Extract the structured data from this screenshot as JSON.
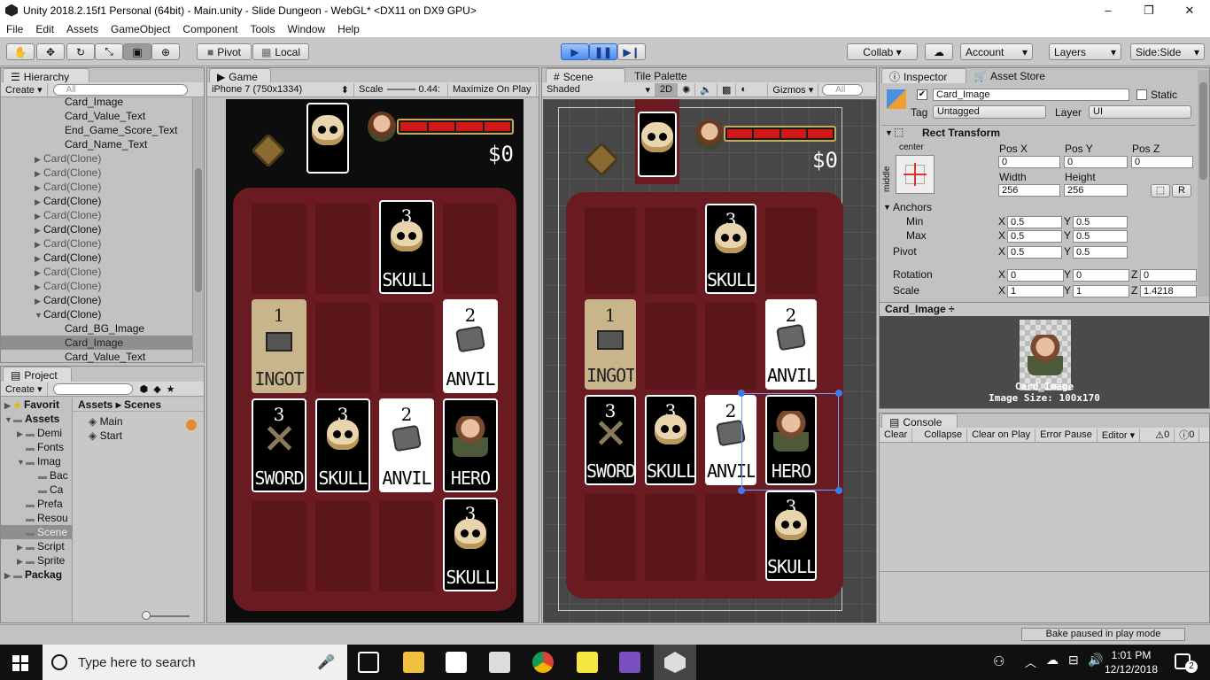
{
  "window": {
    "title": "Unity 2018.2.15f1 Personal (64bit) - Main.unity - Slide Dungeon - WebGL* <DX11 on DX9 GPU>",
    "minimize": "–",
    "maximize": "❐",
    "close": "✕"
  },
  "menu": [
    "File",
    "Edit",
    "Assets",
    "GameObject",
    "Component",
    "Tools",
    "Window",
    "Help"
  ],
  "toolbar": {
    "pivot_label": "Pivot",
    "local_label": "Local",
    "collab_label": "Collab ▾",
    "account_label": "Account",
    "layers_label": "Layers",
    "layout_label": "Side:Side"
  },
  "hierarchy": {
    "tab": "Hierarchy",
    "create": "Create ▾",
    "search_placeholder": "All",
    "rows": [
      {
        "label": "Card_Image",
        "indent": 2,
        "style": "normal",
        "arrow": ""
      },
      {
        "label": "Card_Value_Text",
        "indent": 2,
        "style": "normal",
        "arrow": ""
      },
      {
        "label": "End_Game_Score_Text",
        "indent": 2,
        "style": "normal",
        "arrow": ""
      },
      {
        "label": "Card_Name_Text",
        "indent": 2,
        "style": "normal",
        "arrow": ""
      },
      {
        "label": "Card(Clone)",
        "indent": 1,
        "style": "grey",
        "arrow": "▶"
      },
      {
        "label": "Card(Clone)",
        "indent": 1,
        "style": "grey",
        "arrow": "▶"
      },
      {
        "label": "Card(Clone)",
        "indent": 1,
        "style": "grey",
        "arrow": "▶"
      },
      {
        "label": "Card(Clone)",
        "indent": 1,
        "style": "normal",
        "arrow": "▶"
      },
      {
        "label": "Card(Clone)",
        "indent": 1,
        "style": "grey",
        "arrow": "▶"
      },
      {
        "label": "Card(Clone)",
        "indent": 1,
        "style": "normal",
        "arrow": "▶"
      },
      {
        "label": "Card(Clone)",
        "indent": 1,
        "style": "grey",
        "arrow": "▶"
      },
      {
        "label": "Card(Clone)",
        "indent": 1,
        "style": "normal",
        "arrow": "▶"
      },
      {
        "label": "Card(Clone)",
        "indent": 1,
        "style": "grey",
        "arrow": "▶"
      },
      {
        "label": "Card(Clone)",
        "indent": 1,
        "style": "grey",
        "arrow": "▶"
      },
      {
        "label": "Card(Clone)",
        "indent": 1,
        "style": "normal",
        "arrow": "▶"
      },
      {
        "label": "Card(Clone)",
        "indent": 1,
        "style": "normal",
        "arrow": "▼"
      },
      {
        "label": "Card_BG_Image",
        "indent": 2,
        "style": "normal",
        "arrow": ""
      },
      {
        "label": "Card_Image",
        "indent": 2,
        "style": "sel",
        "arrow": ""
      },
      {
        "label": "Card_Value_Text",
        "indent": 2,
        "style": "normal",
        "arrow": ""
      }
    ]
  },
  "project": {
    "tab": "Project",
    "create": "Create ▾",
    "tree": [
      {
        "label": "Favorit",
        "bold": true,
        "arrow": "▶",
        "indent": 0
      },
      {
        "label": "Assets",
        "bold": true,
        "arrow": "▼",
        "indent": 0
      },
      {
        "label": "Demi",
        "bold": false,
        "arrow": "▶",
        "indent": 1
      },
      {
        "label": "Fonts",
        "bold": false,
        "arrow": "",
        "indent": 1
      },
      {
        "label": "Imag",
        "bold": false,
        "arrow": "▼",
        "indent": 1
      },
      {
        "label": "Bac",
        "bold": false,
        "arrow": "",
        "indent": 2
      },
      {
        "label": "Ca",
        "bold": false,
        "arrow": "",
        "indent": 2
      },
      {
        "label": "Prefa",
        "bold": false,
        "arrow": "",
        "indent": 1
      },
      {
        "label": "Resou",
        "bold": false,
        "arrow": "",
        "indent": 1
      },
      {
        "label": "Scene",
        "bold": false,
        "arrow": "",
        "indent": 1,
        "selected": true
      },
      {
        "label": "Script",
        "bold": false,
        "arrow": "▶",
        "indent": 1
      },
      {
        "label": "Sprite",
        "bold": false,
        "arrow": "▶",
        "indent": 1
      },
      {
        "label": "Packag",
        "bold": true,
        "arrow": "▶",
        "indent": 0
      }
    ],
    "breadcrumb": "Assets ▸ Scenes",
    "files": [
      "Main",
      "Start"
    ]
  },
  "game_view": {
    "tab": "Game",
    "resolution": "iPhone 7 (750x1334)",
    "scale_label": "Scale",
    "scale_value": "0.44:",
    "maximize": "Maximize On Play"
  },
  "scene_view": {
    "tab": "Scene",
    "tab2": "Tile Palette",
    "shading": "Shaded",
    "mode2d": "2D",
    "gizmos": "Gizmos ▾",
    "search": "All"
  },
  "game": {
    "money": "$0",
    "health_segments": 4,
    "top_card": {
      "value": "",
      "name": "",
      "icon": "skull"
    },
    "grid": [
      [
        null,
        null,
        {
          "value": "3",
          "name": "SKULL",
          "icon": "skull",
          "style": "black"
        },
        null
      ],
      [
        {
          "value": "1",
          "name": "INGOT",
          "icon": "ingot",
          "style": "tan"
        },
        null,
        null,
        {
          "value": "2",
          "name": "ANVIL",
          "icon": "anvil",
          "style": "white"
        }
      ],
      [
        {
          "value": "3",
          "name": "SWORD",
          "icon": "sword",
          "style": "black"
        },
        {
          "value": "3",
          "name": "SKULL",
          "icon": "skull",
          "style": "black"
        },
        {
          "value": "2",
          "name": "ANVIL",
          "icon": "anvil",
          "style": "white"
        },
        {
          "value": "",
          "name": "HERO",
          "icon": "hero",
          "style": "black"
        }
      ],
      [
        null,
        null,
        null,
        {
          "value": "3",
          "name": "SKULL",
          "icon": "skull",
          "style": "black"
        }
      ]
    ]
  },
  "inspector": {
    "tab": "Inspector",
    "tab2": "Asset Store",
    "object_name": "Card_Image",
    "static_label": "Static",
    "tag_label": "Tag",
    "tag_value": "Untagged",
    "layer_label": "Layer",
    "layer_value": "UI",
    "rect_transform": "Rect Transform",
    "anchor_h": "center",
    "anchor_v": "middle",
    "pos_x_label": "Pos X",
    "pos_y_label": "Pos Y",
    "pos_z_label": "Pos Z",
    "pos_x": "0",
    "pos_y": "0",
    "pos_z": "0",
    "width_label": "Width",
    "height_label": "Height",
    "width": "256",
    "height": "256",
    "r_button": "R",
    "anchors_label": "Anchors",
    "min_label": "Min",
    "max_label": "Max",
    "anchor_min_x": "0.5",
    "anchor_min_y": "0.5",
    "anchor_max_x": "0.5",
    "anchor_max_y": "0.5",
    "pivot_label": "Pivot",
    "pivot_x": "0.5",
    "pivot_y": "0.5",
    "rotation_label": "Rotation",
    "rot_x": "0",
    "rot_y": "0",
    "rot_z": "0",
    "scale_label": "Scale",
    "scale_x": "1",
    "scale_y": "1",
    "scale_z": "1.4218",
    "x_label": "X",
    "y_label": "Y",
    "z_label": "Z",
    "preview_title": "Card_Image ÷",
    "preview_name": "Card_Image",
    "preview_size": "Image Size: 100x170"
  },
  "console": {
    "tab": "Console",
    "buttons": [
      "Clear",
      "Collapse",
      "Clear on Play",
      "Error Pause",
      "Editor ▾"
    ],
    "warn_count": "0",
    "error_count": "0"
  },
  "status": {
    "text": "Bake paused in play mode"
  },
  "taskbar": {
    "search_placeholder": "Type here to search",
    "time": "1:01 PM",
    "date": "12/12/2018",
    "notif": "2"
  }
}
